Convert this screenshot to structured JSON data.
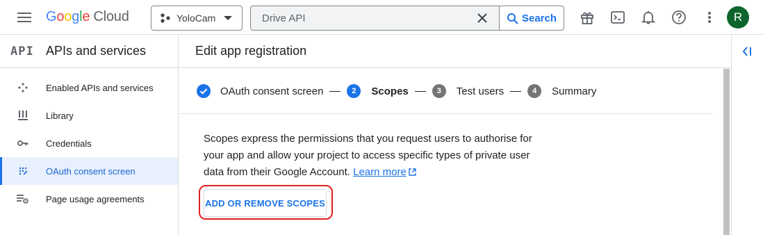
{
  "header": {
    "logo_google": [
      "G",
      "o",
      "o",
      "g",
      "l",
      "e"
    ],
    "logo_product": "Cloud",
    "project_name": "YoloCam",
    "search_value": "Drive API",
    "search_button": "Search",
    "avatar_letter": "R"
  },
  "sidebar": {
    "logo_text": "API",
    "title": "APIs and services",
    "items": [
      {
        "label": "Enabled APIs and services",
        "icon": "enabled-apis-icon",
        "active": false
      },
      {
        "label": "Library",
        "icon": "library-icon",
        "active": false
      },
      {
        "label": "Credentials",
        "icon": "key-icon",
        "active": false
      },
      {
        "label": "OAuth consent screen",
        "icon": "oauth-consent-icon",
        "active": true
      },
      {
        "label": "Page usage agreements",
        "icon": "page-usage-icon",
        "active": false
      }
    ]
  },
  "main": {
    "title": "Edit app registration",
    "steps": [
      {
        "label": "OAuth consent screen",
        "state": "done"
      },
      {
        "number": "2",
        "label": "Scopes",
        "state": "current"
      },
      {
        "number": "3",
        "label": "Test users",
        "state": "pending"
      },
      {
        "number": "4",
        "label": "Summary",
        "state": "pending"
      }
    ],
    "description": "Scopes express the permissions that you request users to authorise for your app and allow your project to access specific types of private user data from their Google Account.",
    "learn_more": "Learn more",
    "scopes_button": "ADD OR REMOVE SCOPES"
  },
  "colors": {
    "accent": "#1a73e8",
    "highlight": "#e02020",
    "avatar": "#0d652d"
  }
}
